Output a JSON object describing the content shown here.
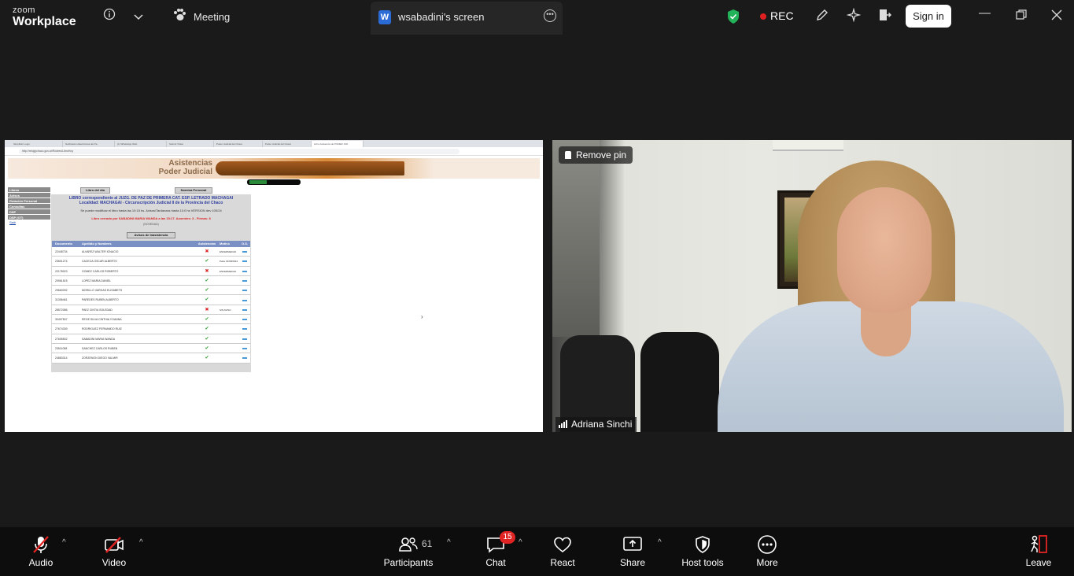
{
  "titlebar": {
    "logo_line1": "zoom",
    "logo_line2": "Workplace",
    "meeting_label": "Meeting",
    "share_tab_icon": "W",
    "share_tab_title": "wsabadini's screen",
    "rec_label": "REC",
    "signin_label": "Sign in",
    "icons": [
      "info-icon",
      "chevron-down-icon",
      "paw-icon",
      "more-icon",
      "shield-icon",
      "record-icon",
      "pen-icon",
      "sparkle-icon",
      "exit-share-icon",
      "minimize-icon",
      "restore-icon",
      "close-icon"
    ],
    "colors": {
      "rec": "#e02020",
      "shield": "#22b25a"
    }
  },
  "shared_screen": {
    "browser_tabs": [
      "Simplistic Login",
      "Notificacion Electronica del Pa",
      "(1) WhatsApp Web",
      "Submit Ticket",
      "Poder Judicial del Chaco",
      "Poder Judicial del Chaco",
      "Libro Asistencia de PODER JUD"
    ],
    "url": "http://relojpjchaco.gov.ar/Rodres/LibroHoy",
    "banner_line1": "Asistencias",
    "banner_line2": "Poder Judicial",
    "menu_items": [
      "Libros",
      "Avisos",
      "Rotación Personal",
      "Consultas",
      "DSP",
      "DSP (OT)"
    ],
    "menu_link": "Salir",
    "top_buttons": [
      "Libro del día",
      "Nomina Personal"
    ],
    "title_line1": "LIBRO correspondiente al JUZG. DE PAZ DE PRIMERA CAT. ESP. LETRADO MACHAGAI",
    "title_line2": "Localidad: MACHAGAI - Circunscripción Judicial II de la Provincia del Chaco",
    "info_line": "Se puede modificar el libro hasta las 10:15 hs. Avisos/Tardanzas hasta 10:0 hs VERSION dev 100/24",
    "alert_line": "Libro cerrado por SABADINI MARIA WANDA a las 15:17. Ausentes: 3 - Firmas: 8",
    "small_line": "(NOVEDAD)",
    "absence_button": "Avisos de Inasistencia",
    "table": {
      "headers": [
        "Documento",
        "Apellido y Nombres",
        "Asistencias",
        "Motivo",
        "O.S."
      ],
      "rows": [
        {
          "doc": "22448734",
          "name": "ALVAREZ WALTER IGNACIO",
          "status": "absent",
          "reason": "ENFERMEDAD Parte 01/08/2024"
        },
        {
          "doc": "23601274",
          "name": "CACECA OSCAR ALBERTO",
          "status": "present",
          "reason": ""
        },
        {
          "doc": "22178023",
          "name": "GOMEZ CARLOS ROBERTO",
          "status": "absent",
          "reason": "ENFERMEDAD"
        },
        {
          "doc": "20961515",
          "name": "LOPEZ MARIA DANIEL",
          "status": "present",
          "reason": ""
        },
        {
          "doc": "29660092",
          "name": "MORILLO VARGAS ELISABETH",
          "status": "present",
          "reason": ""
        },
        {
          "doc": "31306461",
          "name": "PAREDES RUBEN ALBERTO",
          "status": "present",
          "reason": ""
        },
        {
          "doc": "28572086",
          "name": "PAEZ CINTIA SOLEDAD",
          "status": "absent",
          "reason": "SIN AVISO"
        },
        {
          "doc": "30497507",
          "name": "REGE SILVA CINTHIA YOANNA",
          "status": "present",
          "reason": ""
        },
        {
          "doc": "27674339",
          "name": "RODRIGUEZ FERNANDO RUIZ",
          "status": "present",
          "reason": ""
        },
        {
          "doc": "27605502",
          "name": "SABADINI MARIA WANDA",
          "status": "present",
          "reason": ""
        },
        {
          "doc": "23511058",
          "name": "SANCHEZ CARLOS RUBEN",
          "status": "present",
          "reason": ""
        },
        {
          "doc": "24883314",
          "name": "ZORZENON DIEGO VALMIR",
          "status": "present",
          "reason": ""
        }
      ]
    }
  },
  "video": {
    "remove_pin_label": "Remove pin",
    "participant_name": "Adriana Sinchi"
  },
  "toolbar": {
    "audio_label": "Audio",
    "video_label": "Video",
    "participants_label": "Participants",
    "participants_count": "61",
    "chat_label": "Chat",
    "chat_badge": "15",
    "react_label": "React",
    "share_label": "Share",
    "host_tools_label": "Host tools",
    "more_label": "More",
    "leave_label": "Leave",
    "colors": {
      "muted": "#e02424",
      "badge": "#e02424"
    }
  }
}
